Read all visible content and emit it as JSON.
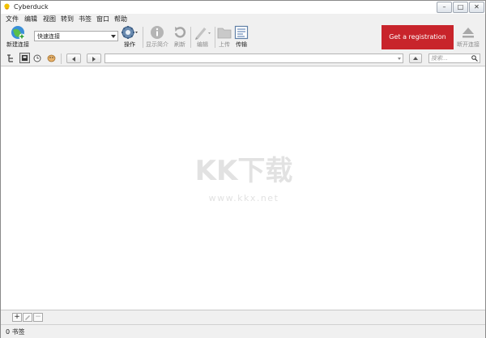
{
  "window": {
    "title": "Cyberduck"
  },
  "menu": [
    "文件",
    "编辑",
    "视图",
    "转到",
    "书签",
    "窗口",
    "帮助"
  ],
  "toolbar": {
    "new_connection": "新建连接",
    "quick_connect": "快速连接",
    "action": "操作",
    "info": "显示简介",
    "refresh": "刷新",
    "edit": "编辑",
    "upload": "上传",
    "transfers": "传输",
    "registration": "Get a registration key!",
    "disconnect": "断开连接"
  },
  "navbar": {
    "search_placeholder": "搜索..."
  },
  "watermark": {
    "logo": "KK下载",
    "url": "www.kkx.net"
  },
  "bottombar": {
    "add": "+",
    "remove": "−"
  },
  "status": {
    "text": "0 书签"
  },
  "colors": {
    "registration_bg": "#c8242b",
    "watermark": "#e0e0e0"
  }
}
